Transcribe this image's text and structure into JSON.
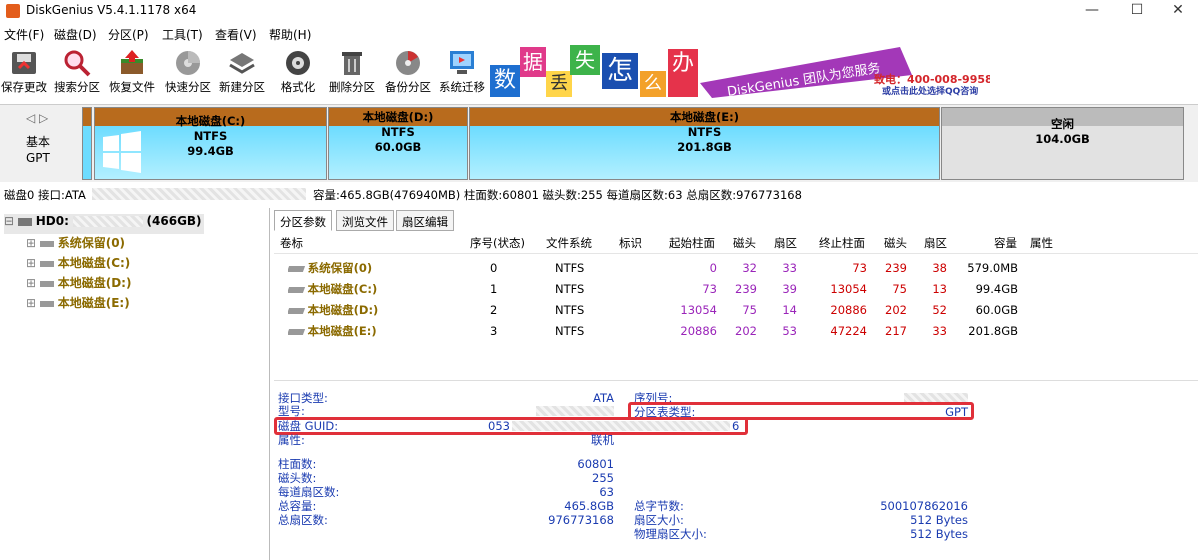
{
  "window": {
    "title": "DiskGenius V5.4.1.1178 x64",
    "min": "—",
    "max": "☐",
    "close": "✕"
  },
  "menu": [
    "文件(F)",
    "磁盘(D)",
    "分区(P)",
    "工具(T)",
    "查看(V)",
    "帮助(H)"
  ],
  "toolbar": [
    {
      "label": "保存更改",
      "icon": "save-icon"
    },
    {
      "label": "搜索分区",
      "icon": "search-icon"
    },
    {
      "label": "恢复文件",
      "icon": "recover-icon"
    },
    {
      "label": "快速分区",
      "icon": "quick-partition-icon"
    },
    {
      "label": "新建分区",
      "icon": "new-partition-icon"
    },
    {
      "label": "格式化",
      "icon": "format-icon"
    },
    {
      "label": "删除分区",
      "icon": "delete-icon"
    },
    {
      "label": "备份分区",
      "icon": "backup-icon"
    },
    {
      "label": "系统迁移",
      "icon": "migrate-icon"
    }
  ],
  "banner": {
    "chars": [
      "数",
      "据",
      "丢",
      "失",
      "怎",
      "么",
      "办"
    ],
    "slogan": "DiskGenius 团队为您服务",
    "phone": "致电：400-008-9958",
    "qq": "或点击此处选择QQ咨询"
  },
  "disk_map": {
    "type_label": "基本",
    "scheme_label": "GPT",
    "partitions": [
      {
        "name": "本地磁盘(C:)",
        "fs": "NTFS",
        "size": "99.4GB"
      },
      {
        "name": "本地磁盘(D:)",
        "fs": "NTFS",
        "size": "60.0GB"
      },
      {
        "name": "本地磁盘(E:)",
        "fs": "NTFS",
        "size": "201.8GB"
      }
    ],
    "free": {
      "name": "空闲",
      "size": "104.0GB"
    }
  },
  "disk_info_line": {
    "left": "磁盘0 接口:ATA",
    "right": "容量:465.8GB(476940MB)  柱面数:60801  磁头数:255  每道扇区数:63  总扇区数:976773168"
  },
  "tree": {
    "root": "HD0:",
    "root_size": "(466GB)",
    "items": [
      "系统保留(0)",
      "本地磁盘(C:)",
      "本地磁盘(D:)",
      "本地磁盘(E:)"
    ]
  },
  "tabs": [
    "分区参数",
    "浏览文件",
    "扇区编辑"
  ],
  "table": {
    "headers": [
      "卷标",
      "序号(状态)",
      "文件系统",
      "标识",
      "起始柱面",
      "磁头",
      "扇区",
      "终止柱面",
      "磁头",
      "扇区",
      "容量",
      "属性"
    ],
    "rows": [
      [
        "系统保留(0)",
        "0",
        "NTFS",
        "",
        "0",
        "32",
        "33",
        "73",
        "239",
        "38",
        "579.0MB",
        ""
      ],
      [
        "本地磁盘(C:)",
        "1",
        "NTFS",
        "",
        "73",
        "239",
        "39",
        "13054",
        "75",
        "13",
        "99.4GB",
        ""
      ],
      [
        "本地磁盘(D:)",
        "2",
        "NTFS",
        "",
        "13054",
        "75",
        "14",
        "20886",
        "202",
        "52",
        "60.0GB",
        ""
      ],
      [
        "本地磁盘(E:)",
        "3",
        "NTFS",
        "",
        "20886",
        "202",
        "53",
        "47224",
        "217",
        "33",
        "201.8GB",
        ""
      ]
    ]
  },
  "details": {
    "interface_label": "接口类型:",
    "interface_value": "ATA",
    "model_label": "型号:",
    "guid_label": "磁盘 GUID:",
    "guid_prefix": "053",
    "guid_suffix": "6",
    "attr_label": "属性:",
    "attr_value": "联机",
    "serial_label": "序列号:",
    "pt_label": "分区表类型:",
    "pt_value": "GPT",
    "cyl_label": "柱面数:",
    "cyl_value": "60801",
    "heads_label": "磁头数:",
    "heads_value": "255",
    "spt_label": "每道扇区数:",
    "spt_value": "63",
    "cap_label": "总容量:",
    "cap_value": "465.8GB",
    "sectors_label": "总扇区数:",
    "sectors_value": "976773168",
    "bytes_label": "总字节数:",
    "bytes_value": "500107862016",
    "sector_size_label": "扇区大小:",
    "sector_size_value": "512 Bytes",
    "phys_sector_label": "物理扇区大小:",
    "phys_sector_value": "512 Bytes"
  },
  "colors": {
    "accent_red": "#e0303a",
    "partition_top": "#b86b1d",
    "partition_body": "#7fe0ff",
    "value_blue": "#1a3bb0",
    "value_purple": "#9a24b9"
  }
}
